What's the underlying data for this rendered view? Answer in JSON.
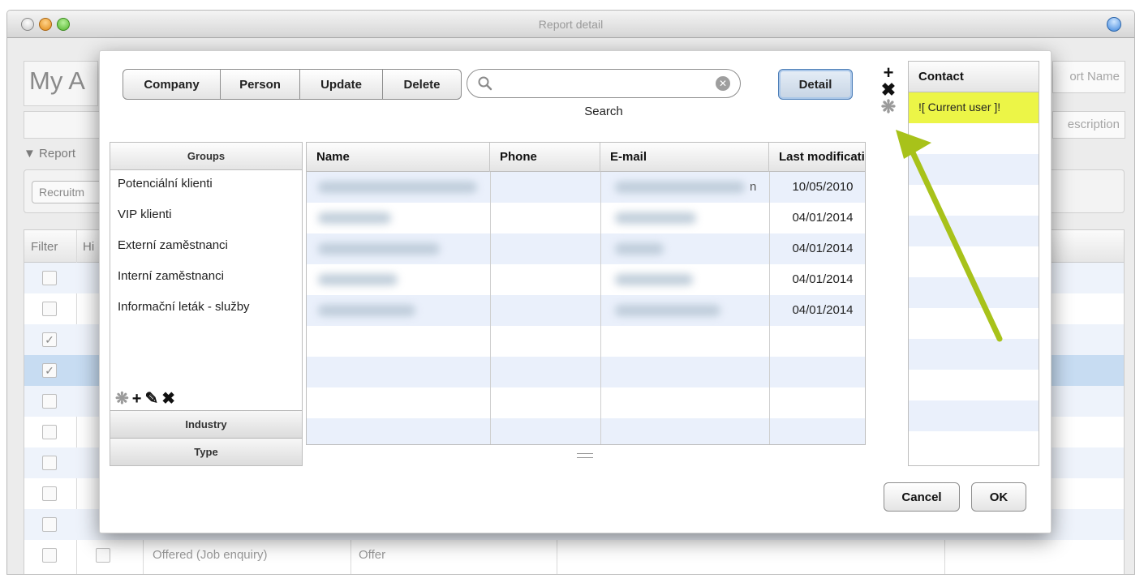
{
  "window": {
    "title": "Report detail"
  },
  "background": {
    "heading": "My A",
    "report_label": "Report",
    "recruit_label": "Recruitm",
    "right_field1": "ort Name",
    "right_field2": "escription",
    "table": {
      "col_filter": "Filter",
      "col_h": "Hi",
      "last_row_text1": "Offered (Job enquiry)",
      "last_row_text2": "Offer"
    }
  },
  "toolbar": {
    "segments": [
      "Company",
      "Person",
      "Update",
      "Delete"
    ],
    "search_value": "",
    "search_label": "Search",
    "detail_label": "Detail"
  },
  "side_icons": {
    "add": "+",
    "remove": "✖",
    "special": "❋"
  },
  "groups": {
    "header": "Groups",
    "items": [
      "Potenciální klienti",
      "VIP klienti",
      "Externí zaměstnanci",
      "Interní zaměstnanci",
      "Informační leták - služby"
    ],
    "tools": {
      "special": "❋",
      "add": "+",
      "edit": "✎",
      "remove": "✖"
    },
    "sections": [
      "Industry",
      "Type"
    ]
  },
  "contacts": {
    "columns": [
      "Name",
      "Phone",
      "E-mail",
      "Last modification"
    ],
    "rows": [
      {
        "date": "10/05/2010",
        "email_suffix": "n"
      },
      {
        "date": "04/01/2014"
      },
      {
        "date": "04/01/2014"
      },
      {
        "date": "04/01/2014"
      },
      {
        "date": "04/01/2014"
      }
    ]
  },
  "contact_list": {
    "header": "Contact",
    "items": [
      "![ Current user ]!"
    ]
  },
  "buttons": {
    "cancel": "Cancel",
    "ok": "OK"
  },
  "colors": {
    "highlight": "#ecf547",
    "arrow": "#a8c21a",
    "selected_row": "#c7dcf2",
    "alt_row": "#eaf0fb"
  }
}
